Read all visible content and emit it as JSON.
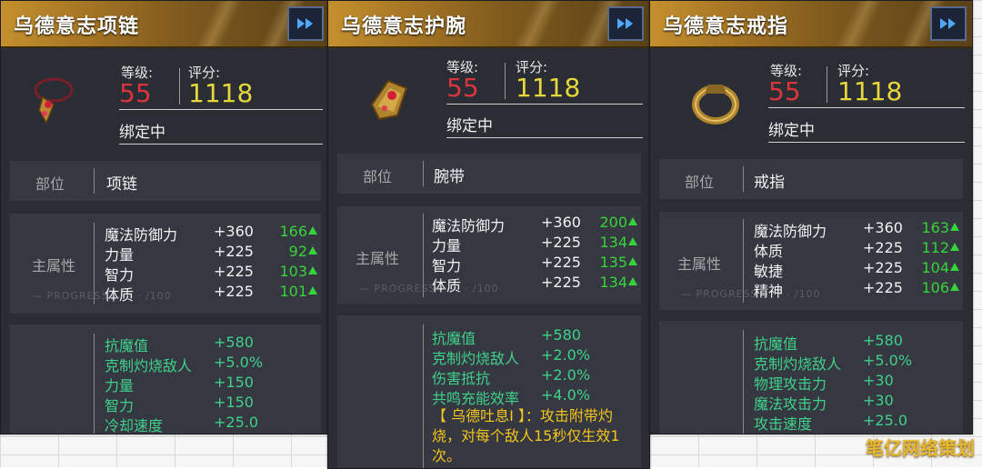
{
  "panels": [
    {
      "title": "乌德意志项链",
      "level_label": "等级:",
      "level": "55",
      "score_label": "评分:",
      "score": "1118",
      "bound": "绑定中",
      "slot_label": "部位",
      "slot": "项链",
      "main_label": "主属性",
      "icon": "necklace-icon",
      "main_stats": [
        {
          "name": "魔法防御力",
          "value": "+360",
          "up": "166"
        },
        {
          "name": "力量",
          "value": "+225",
          "up": "92"
        },
        {
          "name": "智力",
          "value": "+225",
          "up": "103"
        },
        {
          "name": "体质",
          "value": "+225",
          "up": "101"
        }
      ],
      "sub_stats": [
        {
          "name": "抗魔值",
          "value": "+580"
        },
        {
          "name": "克制灼烧敌人",
          "value": "+5.0%"
        },
        {
          "name": "力量",
          "value": "+150"
        },
        {
          "name": "智力",
          "value": "+150"
        },
        {
          "name": "冷却速度",
          "value": "+25.0"
        }
      ],
      "special": ""
    },
    {
      "title": "乌德意志护腕",
      "level_label": "等级:",
      "level": "55",
      "score_label": "评分:",
      "score": "1118",
      "bound": "绑定中",
      "slot_label": "部位",
      "slot": "腕带",
      "main_label": "主属性",
      "icon": "bracer-icon",
      "main_stats": [
        {
          "name": "魔法防御力",
          "value": "+360",
          "up": "200"
        },
        {
          "name": "力量",
          "value": "+225",
          "up": "134"
        },
        {
          "name": "智力",
          "value": "+225",
          "up": "135"
        },
        {
          "name": "体质",
          "value": "+225",
          "up": "134"
        }
      ],
      "sub_stats": [
        {
          "name": "抗魔值",
          "value": "+580"
        },
        {
          "name": "克制灼烧敌人",
          "value": "+2.0%"
        },
        {
          "name": "伤害抵抗",
          "value": "+2.0%"
        },
        {
          "name": "共鸣充能效率",
          "value": "+4.0%"
        }
      ],
      "special": "【 乌德吐息Ⅰ 】：攻击附带灼烧，对每个敌人15秒仅生效1次。"
    },
    {
      "title": "乌德意志戒指",
      "level_label": "等级:",
      "level": "55",
      "score_label": "评分:",
      "score": "1118",
      "bound": "绑定中",
      "slot_label": "部位",
      "slot": "戒指",
      "main_label": "主属性",
      "icon": "ring-icon",
      "main_stats": [
        {
          "name": "魔法防御力",
          "value": "+360",
          "up": "163"
        },
        {
          "name": "体质",
          "value": "+225",
          "up": "112"
        },
        {
          "name": "敏捷",
          "value": "+225",
          "up": "104"
        },
        {
          "name": "精神",
          "value": "+225",
          "up": "106"
        }
      ],
      "sub_stats": [
        {
          "name": "抗魔值",
          "value": "+580"
        },
        {
          "name": "克制灼烧敌人",
          "value": "+5.0%"
        },
        {
          "name": "物理攻击力",
          "value": "+30"
        },
        {
          "name": "魔法攻击力",
          "value": "+30"
        },
        {
          "name": "攻击速度",
          "value": "+25.0"
        }
      ],
      "special": ""
    }
  ],
  "watermark": "笔亿网络策划",
  "colors": {
    "level": "#d9363b",
    "score": "#e6d83a",
    "upgrade": "#36d33a",
    "sub_stat": "#3fd08a",
    "special": "#f4c51c"
  }
}
